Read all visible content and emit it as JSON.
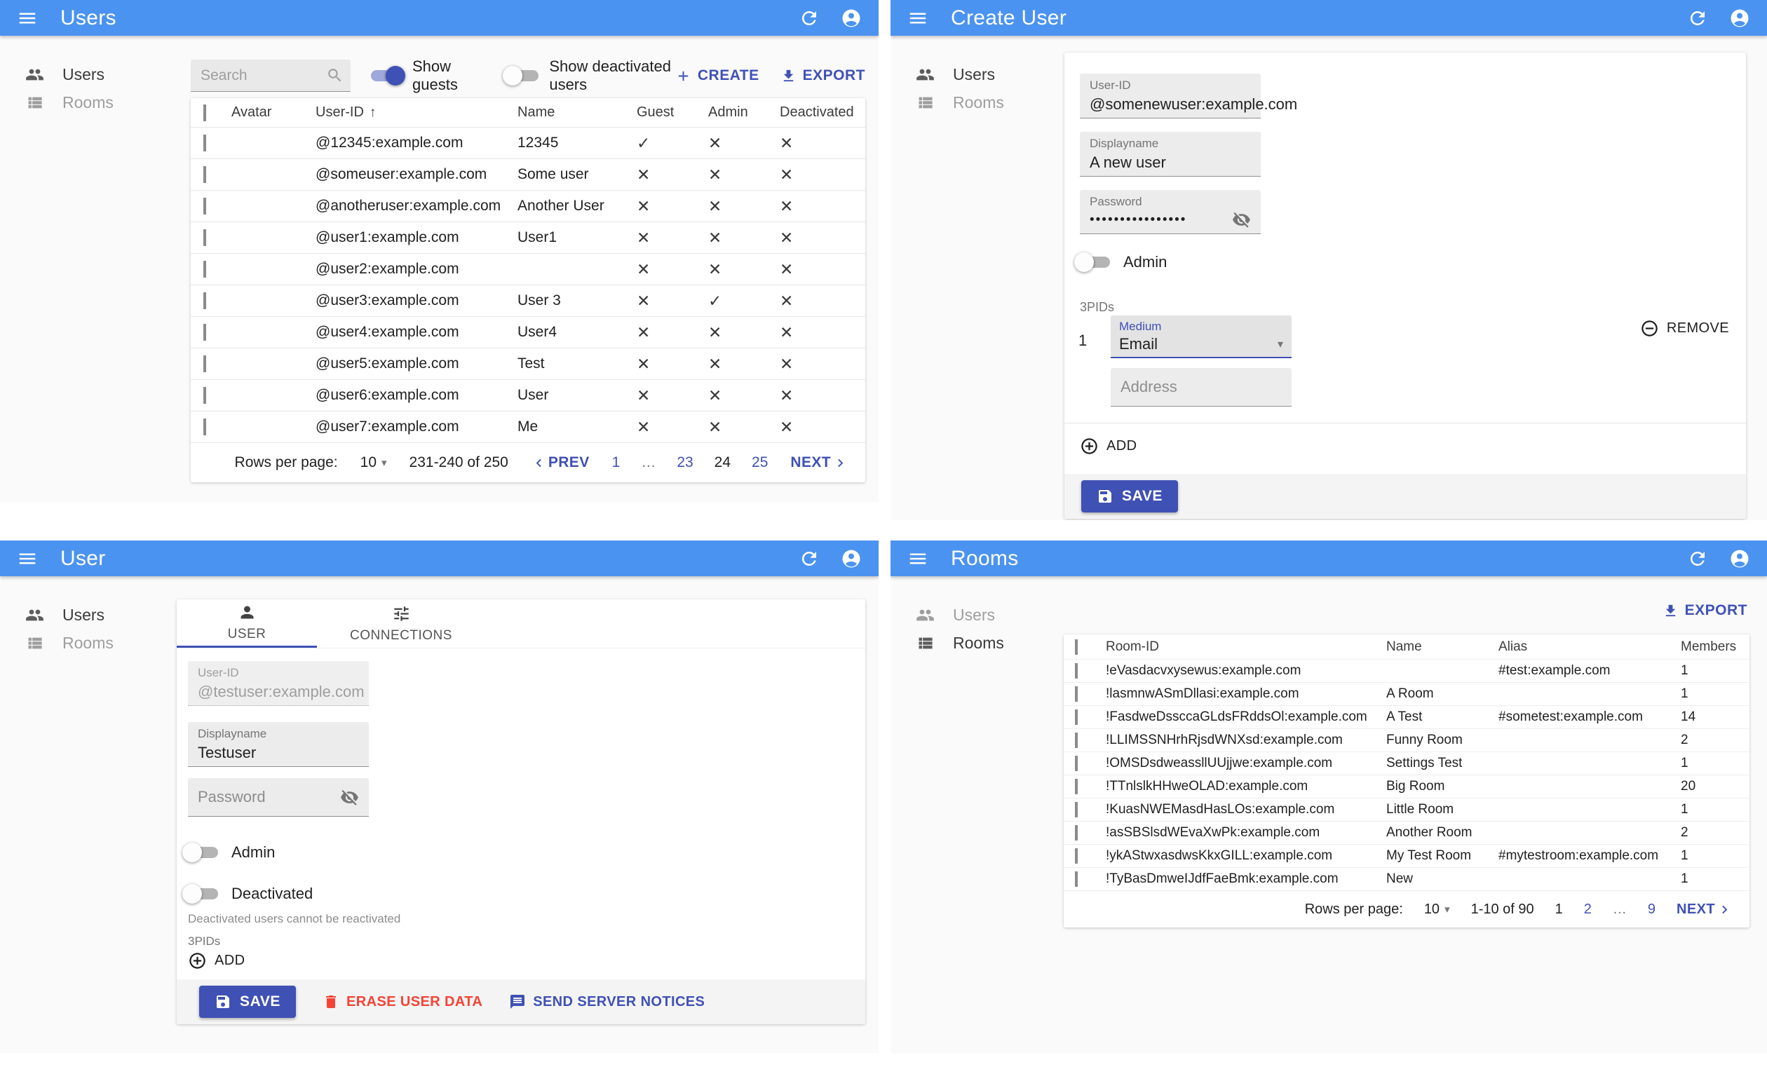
{
  "glyphs": {
    "check": "✓",
    "cross": "✕",
    "sort_asc": "↑",
    "dropdown_arrow": "▾"
  },
  "theme": {
    "app_bar": "#4b93f0",
    "primary": "#3f51b5",
    "danger": "#f44336",
    "page_bg": "#fafafa"
  },
  "panels": {
    "users_list": {
      "app_bar": {
        "title": "Users"
      },
      "sidebar": {
        "users_label": "Users",
        "rooms_label": "Rooms",
        "active": "users"
      },
      "toolbar": {
        "search_placeholder": "Search",
        "show_guests_label": "Show guests",
        "show_guests_on": true,
        "show_deactivated_label": "Show deactivated users",
        "show_deactivated_on": false,
        "create_label": "CREATE",
        "export_label": "EXPORT"
      },
      "table": {
        "headers": {
          "avatar": "Avatar",
          "user_id": "User-ID",
          "name": "Name",
          "guest": "Guest",
          "admin": "Admin",
          "deactivated": "Deactivated"
        },
        "rows": [
          {
            "user_id": "@12345:example.com",
            "name": "12345",
            "guest": true,
            "admin": false,
            "deactivated": false
          },
          {
            "user_id": "@someuser:example.com",
            "name": "Some user",
            "guest": false,
            "admin": false,
            "deactivated": false
          },
          {
            "user_id": "@anotheruser:example.com",
            "name": "Another User",
            "guest": false,
            "admin": false,
            "deactivated": false
          },
          {
            "user_id": "@user1:example.com",
            "name": "User1",
            "guest": false,
            "admin": false,
            "deactivated": false
          },
          {
            "user_id": "@user2:example.com",
            "name": "",
            "guest": false,
            "admin": false,
            "deactivated": false
          },
          {
            "user_id": "@user3:example.com",
            "name": "User 3",
            "guest": false,
            "admin": true,
            "deactivated": false
          },
          {
            "user_id": "@user4:example.com",
            "name": "User4",
            "guest": false,
            "admin": false,
            "deactivated": false
          },
          {
            "user_id": "@user5:example.com",
            "name": "Test",
            "guest": false,
            "admin": false,
            "deactivated": false
          },
          {
            "user_id": "@user6:example.com",
            "name": "User",
            "guest": false,
            "admin": false,
            "deactivated": false
          },
          {
            "user_id": "@user7:example.com",
            "name": "Me",
            "guest": false,
            "admin": false,
            "deactivated": false
          }
        ]
      },
      "pagination": {
        "rows_per_page_label": "Rows per page:",
        "rows_per_page": "10",
        "range": "231-240 of 250",
        "prev_label": "PREV",
        "next_label": "NEXT",
        "pages": [
          {
            "label": "1",
            "type": "link"
          },
          {
            "label": "…",
            "type": "ellipsis"
          },
          {
            "label": "23",
            "type": "link"
          },
          {
            "label": "24",
            "type": "current"
          },
          {
            "label": "25",
            "type": "link"
          }
        ]
      }
    },
    "create_user": {
      "app_bar": {
        "title": "Create User"
      },
      "sidebar": {
        "users_label": "Users",
        "rooms_label": "Rooms",
        "active": "users"
      },
      "form": {
        "user_id": {
          "label": "User-ID",
          "value": "@somenewuser:example.com"
        },
        "displayname": {
          "label": "Displayname",
          "value": "A new user"
        },
        "password": {
          "label": "Password",
          "value": "••••••••••••••••"
        },
        "admin_label": "Admin",
        "admin_on": false,
        "threepids_label": "3PIDs",
        "threepid_index": "1",
        "medium": {
          "label": "Medium",
          "value": "Email"
        },
        "remove_label": "REMOVE",
        "address_placeholder": "Address",
        "add_label": "ADD",
        "save_label": "SAVE"
      }
    },
    "user_edit": {
      "app_bar": {
        "title": "User"
      },
      "sidebar": {
        "users_label": "Users",
        "rooms_label": "Rooms",
        "active": "users"
      },
      "tabs": {
        "user": "USER",
        "connections": "CONNECTIONS",
        "active": "user"
      },
      "form": {
        "user_id": {
          "label": "User-ID",
          "value": "@testuser:example.com"
        },
        "displayname": {
          "label": "Displayname",
          "value": "Testuser"
        },
        "password_placeholder": "Password",
        "admin_label": "Admin",
        "admin_on": false,
        "deactivated_label": "Deactivated",
        "deactivated_on": false,
        "deactivated_caption": "Deactivated users cannot be reactivated",
        "threepids_label": "3PIDs",
        "add_label": "ADD"
      },
      "footer": {
        "save_label": "SAVE",
        "erase_label": "ERASE USER DATA",
        "notices_label": "SEND SERVER NOTICES"
      }
    },
    "rooms_list": {
      "app_bar": {
        "title": "Rooms"
      },
      "sidebar": {
        "users_label": "Users",
        "rooms_label": "Rooms",
        "active": "rooms"
      },
      "toolbar": {
        "export_label": "EXPORT"
      },
      "table": {
        "headers": {
          "room_id": "Room-ID",
          "name": "Name",
          "alias": "Alias",
          "members": "Members"
        },
        "rows": [
          {
            "room_id": "!eVasdacvxysewus:example.com",
            "name": "",
            "alias": "#test:example.com",
            "members": "1"
          },
          {
            "room_id": "!lasmnwASmDllasi:example.com",
            "name": "A Room",
            "alias": "",
            "members": "1"
          },
          {
            "room_id": "!FasdweDssccaGLdsFRddsOl:example.com",
            "name": "A Test",
            "alias": "#sometest:example.com",
            "members": "14"
          },
          {
            "room_id": "!LLIMSSNHrhRjsdWNXsd:example.com",
            "name": "Funny Room",
            "alias": "",
            "members": "2"
          },
          {
            "room_id": "!OMSDsdweassllUUjjwe:example.com",
            "name": "Settings Test",
            "alias": "",
            "members": "1"
          },
          {
            "room_id": "!TTnlslkHHweOLAD:example.com",
            "name": "Big Room",
            "alias": "",
            "members": "20"
          },
          {
            "room_id": "!KuasNWEMasdHasLOs:example.com",
            "name": "Little Room",
            "alias": "",
            "members": "1"
          },
          {
            "room_id": "!asSBSlsdWEvaXwPk:example.com",
            "name": "Another Room",
            "alias": "",
            "members": "2"
          },
          {
            "room_id": "!ykAStwxasdwsKkxGILL:example.com",
            "name": "My Test Room",
            "alias": "#mytestroom:example.com",
            "members": "1"
          },
          {
            "room_id": "!TyBasDmweIJdfFaeBmk:example.com",
            "name": "New",
            "alias": "",
            "members": "1"
          }
        ]
      },
      "pagination": {
        "rows_per_page_label": "Rows per page:",
        "rows_per_page": "10",
        "range": "1-10 of 90",
        "next_label": "NEXT",
        "pages": [
          {
            "label": "1",
            "type": "current"
          },
          {
            "label": "2",
            "type": "link"
          },
          {
            "label": "…",
            "type": "ellipsis"
          },
          {
            "label": "9",
            "type": "link"
          }
        ]
      }
    }
  }
}
